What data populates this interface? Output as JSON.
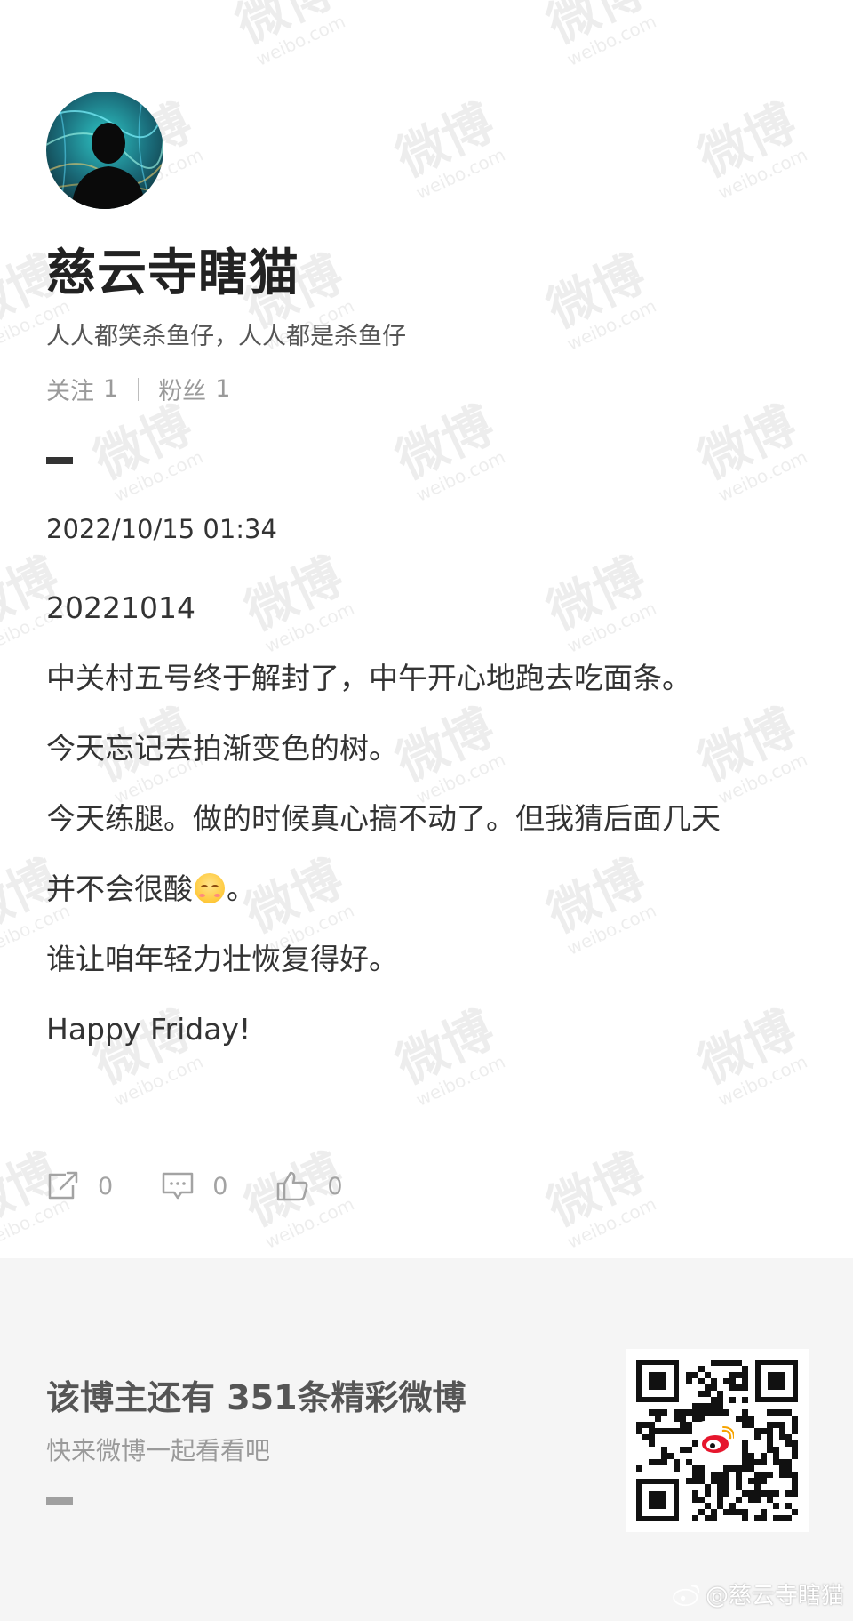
{
  "watermark": {
    "cn": "微博",
    "en": "weibo.com"
  },
  "profile": {
    "name": "慈云寺瞎猫",
    "bio": "人人都笑杀鱼仔，人人都是杀鱼仔",
    "following_label": "关注",
    "following_count": "1",
    "followers_label": "粉丝",
    "followers_count": "1"
  },
  "post": {
    "date": "2022/10/15 01:34",
    "lines": [
      "20221014",
      "中关村五号终于解封了，中午开心地跑去吃面条。",
      "今天忘记去拍渐变色的树。",
      "今天练腿。做的时候真心搞不动了。但我猜后面几天",
      "并不会很酸",
      "。",
      "谁让咱年轻力壮恢复得好。",
      "Happy Friday!"
    ],
    "emoji_icon": "smile-emoji-icon"
  },
  "actions": {
    "repost_count": "0",
    "comment_count": "0",
    "like_count": "0"
  },
  "footer": {
    "title": "该博主还有 351条精彩微博",
    "subtitle": "快来微博一起看看吧"
  },
  "credit": {
    "text": "@慈云寺瞎猫"
  },
  "colors": {
    "text": "#333333",
    "muted": "#9a9a9a",
    "footer_bg": "#f5f5f5",
    "weibo_red": "#e6162d"
  }
}
